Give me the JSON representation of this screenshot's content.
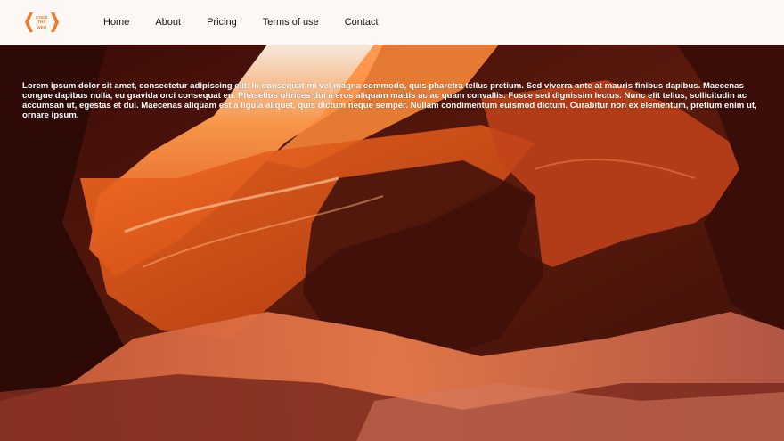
{
  "brand": {
    "logo_lines": [
      "CODE",
      "THE",
      "WEB"
    ],
    "accent_color": "#f07a2c"
  },
  "nav": {
    "items": [
      {
        "label": "Home"
      },
      {
        "label": "About"
      },
      {
        "label": "Pricing"
      },
      {
        "label": "Terms of use"
      },
      {
        "label": "Contact"
      }
    ]
  },
  "hero": {
    "image": "canyon-rock-photo",
    "text": "Lorem ipsum dolor sit amet, consectetur adipiscing elit. In consequat mi vel magna commodo, quis pharetra tellus pretium. Sed viverra ante at mauris finibus dapibus. Maecenas congue dapibus nulla, eu gravida orci consequat eu. Phasellus ultrices dui a eros aliquam mattis ac ac quam convallis. Fusce sed dignissim lectus. Nunc elit tellus, sollicitudin ac accumsan ut, egestas et dui. Maecenas aliquam est a ligula aliquet, quis dictum neque semper. Nullam condimentum euismod dictum. Curabitur non ex elementum, pretium enim ut, ornare ipsum."
  }
}
